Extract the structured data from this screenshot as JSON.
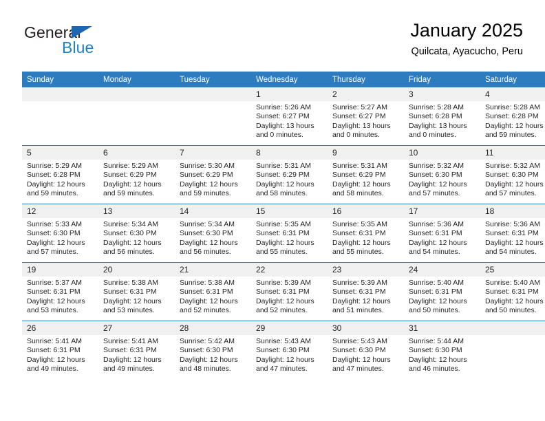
{
  "logo": {
    "word_top": "General",
    "word_bottom": "Blue",
    "triangle_color": "#1b67b2",
    "blue_text_color": "#2081c6",
    "dark_text_color": "#231f20"
  },
  "header": {
    "title": "January 2025",
    "subtitle": "Quilcata, Ayacucho, Peru"
  },
  "theme": {
    "header_blue": "#2e7cc0",
    "daynum_gray": "#f0f0f0",
    "text_dark": "#231f20"
  },
  "calendar": {
    "weekday_headers": [
      "Sunday",
      "Monday",
      "Tuesday",
      "Wednesday",
      "Thursday",
      "Friday",
      "Saturday"
    ],
    "labels": {
      "sunrise": "Sunrise:",
      "sunset": "Sunset:",
      "daylight": "Daylight:"
    },
    "weeks": [
      [
        {
          "day": "",
          "sunrise": "",
          "sunset": "",
          "daylight": "",
          "empty": true
        },
        {
          "day": "",
          "sunrise": "",
          "sunset": "",
          "daylight": "",
          "empty": true
        },
        {
          "day": "",
          "sunrise": "",
          "sunset": "",
          "daylight": "",
          "empty": true
        },
        {
          "day": "1",
          "sunrise": "Sunrise: 5:26 AM",
          "sunset": "Sunset: 6:27 PM",
          "daylight": "Daylight: 13 hours and 0 minutes."
        },
        {
          "day": "2",
          "sunrise": "Sunrise: 5:27 AM",
          "sunset": "Sunset: 6:27 PM",
          "daylight": "Daylight: 13 hours and 0 minutes."
        },
        {
          "day": "3",
          "sunrise": "Sunrise: 5:28 AM",
          "sunset": "Sunset: 6:28 PM",
          "daylight": "Daylight: 13 hours and 0 minutes."
        },
        {
          "day": "4",
          "sunrise": "Sunrise: 5:28 AM",
          "sunset": "Sunset: 6:28 PM",
          "daylight": "Daylight: 12 hours and 59 minutes."
        }
      ],
      [
        {
          "day": "5",
          "sunrise": "Sunrise: 5:29 AM",
          "sunset": "Sunset: 6:28 PM",
          "daylight": "Daylight: 12 hours and 59 minutes."
        },
        {
          "day": "6",
          "sunrise": "Sunrise: 5:29 AM",
          "sunset": "Sunset: 6:29 PM",
          "daylight": "Daylight: 12 hours and 59 minutes."
        },
        {
          "day": "7",
          "sunrise": "Sunrise: 5:30 AM",
          "sunset": "Sunset: 6:29 PM",
          "daylight": "Daylight: 12 hours and 59 minutes."
        },
        {
          "day": "8",
          "sunrise": "Sunrise: 5:31 AM",
          "sunset": "Sunset: 6:29 PM",
          "daylight": "Daylight: 12 hours and 58 minutes."
        },
        {
          "day": "9",
          "sunrise": "Sunrise: 5:31 AM",
          "sunset": "Sunset: 6:29 PM",
          "daylight": "Daylight: 12 hours and 58 minutes."
        },
        {
          "day": "10",
          "sunrise": "Sunrise: 5:32 AM",
          "sunset": "Sunset: 6:30 PM",
          "daylight": "Daylight: 12 hours and 57 minutes."
        },
        {
          "day": "11",
          "sunrise": "Sunrise: 5:32 AM",
          "sunset": "Sunset: 6:30 PM",
          "daylight": "Daylight: 12 hours and 57 minutes."
        }
      ],
      [
        {
          "day": "12",
          "sunrise": "Sunrise: 5:33 AM",
          "sunset": "Sunset: 6:30 PM",
          "daylight": "Daylight: 12 hours and 57 minutes."
        },
        {
          "day": "13",
          "sunrise": "Sunrise: 5:34 AM",
          "sunset": "Sunset: 6:30 PM",
          "daylight": "Daylight: 12 hours and 56 minutes."
        },
        {
          "day": "14",
          "sunrise": "Sunrise: 5:34 AM",
          "sunset": "Sunset: 6:30 PM",
          "daylight": "Daylight: 12 hours and 56 minutes."
        },
        {
          "day": "15",
          "sunrise": "Sunrise: 5:35 AM",
          "sunset": "Sunset: 6:31 PM",
          "daylight": "Daylight: 12 hours and 55 minutes."
        },
        {
          "day": "16",
          "sunrise": "Sunrise: 5:35 AM",
          "sunset": "Sunset: 6:31 PM",
          "daylight": "Daylight: 12 hours and 55 minutes."
        },
        {
          "day": "17",
          "sunrise": "Sunrise: 5:36 AM",
          "sunset": "Sunset: 6:31 PM",
          "daylight": "Daylight: 12 hours and 54 minutes."
        },
        {
          "day": "18",
          "sunrise": "Sunrise: 5:36 AM",
          "sunset": "Sunset: 6:31 PM",
          "daylight": "Daylight: 12 hours and 54 minutes."
        }
      ],
      [
        {
          "day": "19",
          "sunrise": "Sunrise: 5:37 AM",
          "sunset": "Sunset: 6:31 PM",
          "daylight": "Daylight: 12 hours and 53 minutes."
        },
        {
          "day": "20",
          "sunrise": "Sunrise: 5:38 AM",
          "sunset": "Sunset: 6:31 PM",
          "daylight": "Daylight: 12 hours and 53 minutes."
        },
        {
          "day": "21",
          "sunrise": "Sunrise: 5:38 AM",
          "sunset": "Sunset: 6:31 PM",
          "daylight": "Daylight: 12 hours and 52 minutes."
        },
        {
          "day": "22",
          "sunrise": "Sunrise: 5:39 AM",
          "sunset": "Sunset: 6:31 PM",
          "daylight": "Daylight: 12 hours and 52 minutes."
        },
        {
          "day": "23",
          "sunrise": "Sunrise: 5:39 AM",
          "sunset": "Sunset: 6:31 PM",
          "daylight": "Daylight: 12 hours and 51 minutes."
        },
        {
          "day": "24",
          "sunrise": "Sunrise: 5:40 AM",
          "sunset": "Sunset: 6:31 PM",
          "daylight": "Daylight: 12 hours and 50 minutes."
        },
        {
          "day": "25",
          "sunrise": "Sunrise: 5:40 AM",
          "sunset": "Sunset: 6:31 PM",
          "daylight": "Daylight: 12 hours and 50 minutes."
        }
      ],
      [
        {
          "day": "26",
          "sunrise": "Sunrise: 5:41 AM",
          "sunset": "Sunset: 6:31 PM",
          "daylight": "Daylight: 12 hours and 49 minutes."
        },
        {
          "day": "27",
          "sunrise": "Sunrise: 5:41 AM",
          "sunset": "Sunset: 6:31 PM",
          "daylight": "Daylight: 12 hours and 49 minutes."
        },
        {
          "day": "28",
          "sunrise": "Sunrise: 5:42 AM",
          "sunset": "Sunset: 6:30 PM",
          "daylight": "Daylight: 12 hours and 48 minutes."
        },
        {
          "day": "29",
          "sunrise": "Sunrise: 5:43 AM",
          "sunset": "Sunset: 6:30 PM",
          "daylight": "Daylight: 12 hours and 47 minutes."
        },
        {
          "day": "30",
          "sunrise": "Sunrise: 5:43 AM",
          "sunset": "Sunset: 6:30 PM",
          "daylight": "Daylight: 12 hours and 47 minutes."
        },
        {
          "day": "31",
          "sunrise": "Sunrise: 5:44 AM",
          "sunset": "Sunset: 6:30 PM",
          "daylight": "Daylight: 12 hours and 46 minutes."
        },
        {
          "day": "",
          "sunrise": "",
          "sunset": "",
          "daylight": "",
          "empty": true
        }
      ]
    ]
  }
}
